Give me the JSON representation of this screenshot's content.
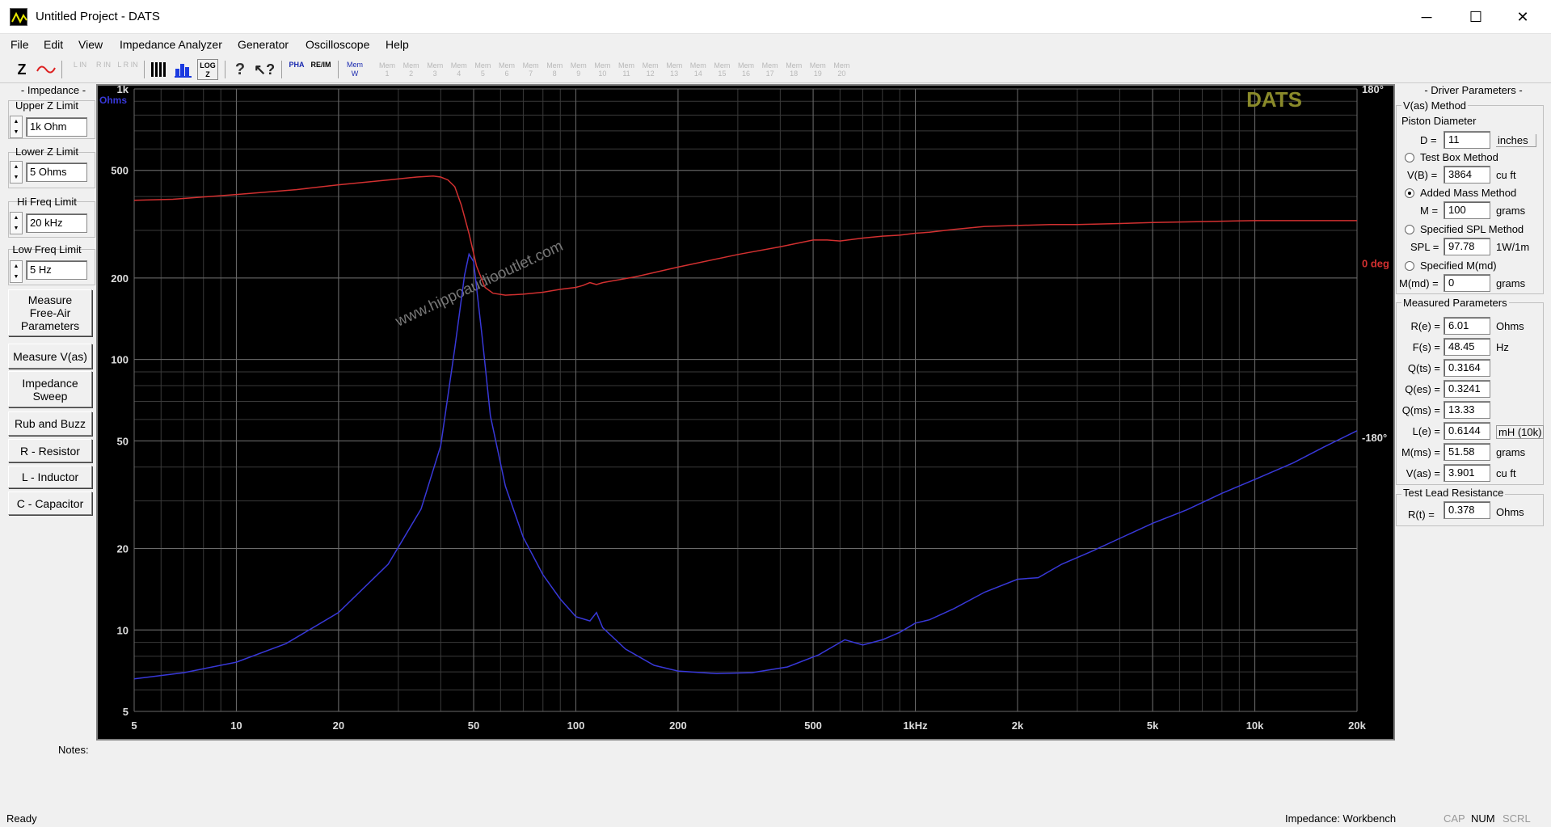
{
  "window": {
    "title": "Untitled Project - DATS",
    "minimize": "─",
    "maximize": "☐",
    "close": "✕"
  },
  "menu": [
    "File",
    "Edit",
    "View",
    "Impedance Analyzer",
    "Generator",
    "Oscilloscope",
    "Help"
  ],
  "toolbar": {
    "icons": [
      "impedance-z-icon",
      "phase-wave-icon",
      "l-in-icon",
      "r-in-icon",
      "lr-in-icon",
      "piano-keys-icon",
      "bar-chart-icon",
      "log-z-icon",
      "help-icon",
      "whats-this-icon",
      "phase-icon",
      "re-im-icon",
      "mem-w-icon"
    ],
    "z_label": "Z",
    "loc_label": "LOG Z",
    "pha_label": "PHA",
    "reim_label": "RE/IM",
    "memw_label": "Mem W",
    "l_in": "L IN",
    "r_in": "R IN",
    "lr_in": "L R IN",
    "mem_slots": [
      "1",
      "2",
      "3",
      "4",
      "5",
      "6",
      "7",
      "8",
      "9",
      "10",
      "11",
      "12",
      "13",
      "14",
      "15",
      "16",
      "17",
      "18",
      "19",
      "20"
    ],
    "mem_label": "Mem"
  },
  "left": {
    "header": "- Impedance -",
    "upper_z": {
      "label": "Upper Z Limit",
      "value": "1k Ohm"
    },
    "lower_z": {
      "label": "Lower Z Limit",
      "value": "5 Ohms"
    },
    "hi_freq": {
      "label": "Hi Freq Limit",
      "value": "20 kHz"
    },
    "low_freq": {
      "label": "Low Freq Limit",
      "value": "5 Hz"
    },
    "buttons": [
      "Measure\nFree-Air\nParameters",
      "Measure V(as)",
      "Impedance\nSweep",
      "Rub and Buzz",
      "R - Resistor",
      "L - Inductor",
      "C - Capacitor"
    ]
  },
  "notes_label": "Notes:",
  "right": {
    "header": "- Driver Parameters -",
    "vas_method": "V(as) Method",
    "piston_diameter": "Piston Diameter",
    "d": {
      "label": "D =",
      "value": "11",
      "unit": "inches"
    },
    "test_box": {
      "label": "Test Box Method",
      "selected": false
    },
    "vb": {
      "label": "V(B) =",
      "value": "3864",
      "unit": "cu ft"
    },
    "added_mass": {
      "label": "Added Mass Method",
      "selected": true
    },
    "m": {
      "label": "M =",
      "value": "100",
      "unit": "grams"
    },
    "spl_method": {
      "label": "Specified SPL Method",
      "selected": false
    },
    "spl": {
      "label": "SPL =",
      "value": "97.78",
      "unit": "1W/1m"
    },
    "mmd_method": {
      "label": "Specified M(md)",
      "selected": false
    },
    "mmd": {
      "label": "M(md) =",
      "value": "0",
      "unit": "grams"
    },
    "measured_header": "Measured Parameters",
    "measured": [
      {
        "label": "R(e) =",
        "value": "6.01",
        "unit": "Ohms"
      },
      {
        "label": "F(s) =",
        "value": "48.45",
        "unit": "Hz"
      },
      {
        "label": "Q(ts) =",
        "value": "0.3164",
        "unit": ""
      },
      {
        "label": "Q(es) =",
        "value": "0.3241",
        "unit": ""
      },
      {
        "label": "Q(ms) =",
        "value": "13.33",
        "unit": ""
      },
      {
        "label": "L(e) =",
        "value": "0.6144",
        "unit": "mH (10k)"
      },
      {
        "label": "M(ms) =",
        "value": "51.58",
        "unit": "grams"
      },
      {
        "label": "V(as) =",
        "value": "3.901",
        "unit": "cu ft"
      }
    ],
    "test_lead_header": "Test Lead Resistance",
    "rt": {
      "label": "R(t) =",
      "value": "0.378",
      "unit": "Ohms"
    }
  },
  "status": {
    "left": "Ready",
    "mode": "Impedance: Workbench",
    "cap": "CAP",
    "num": "NUM",
    "scrl": "SCRL"
  },
  "chart_data": {
    "type": "line",
    "brand": "DATS",
    "watermark": "www.hippoaudiooutlet.com",
    "x_scale": "log",
    "y_scale": "log",
    "xlim": [
      5,
      20000
    ],
    "ylim": [
      5,
      1000
    ],
    "y_unit": "Ohms",
    "x_ticks": [
      "5",
      "10",
      "20",
      "50",
      "100",
      "200",
      "500",
      "1kHz",
      "2k",
      "5k",
      "10k",
      "20k"
    ],
    "x_tick_values": [
      5,
      10,
      20,
      50,
      100,
      200,
      500,
      1000,
      2000,
      5000,
      10000,
      20000
    ],
    "y_ticks": [
      "1k",
      "500",
      "200",
      "100",
      "50",
      "20",
      "10",
      "5"
    ],
    "y_tick_values": [
      1000,
      500,
      200,
      100,
      50,
      20,
      10,
      5
    ],
    "phase_ticks": [
      "180°",
      "0 deg",
      "-180°"
    ],
    "phase_tick_values": [
      180,
      0,
      -180
    ],
    "phase_lim": [
      -180,
      180
    ],
    "grid": true,
    "colors": {
      "impedance": "#3838d8",
      "phase": "#d23030",
      "grid": "#3a3a3a",
      "brand": "#8a8a2a",
      "watermark": "#777777"
    },
    "series": [
      {
        "name": "impedance",
        "x": [
          5,
          7,
          10,
          14,
          20,
          28,
          35,
          40,
          44,
          47,
          48.45,
          50,
          53,
          56,
          62,
          70,
          80,
          90,
          100,
          110,
          115,
          120,
          140,
          170,
          200,
          260,
          330,
          420,
          520,
          620,
          700,
          800,
          900,
          1000,
          1100,
          1300,
          1600,
          2000,
          2300,
          2700,
          3300,
          4000,
          5000,
          6300,
          8000,
          10000,
          13000,
          16000,
          20000
        ],
        "y": [
          6.6,
          6.95,
          7.6,
          8.9,
          11.6,
          17.5,
          28,
          48,
          110,
          205,
          245,
          230,
          120,
          62,
          34,
          22,
          16,
          13,
          11.2,
          10.8,
          11.6,
          10.2,
          8.5,
          7.4,
          7.05,
          6.9,
          6.95,
          7.3,
          8.1,
          9.2,
          8.8,
          9.2,
          9.8,
          10.6,
          10.9,
          12,
          13.8,
          15.4,
          15.6,
          17.5,
          19.5,
          21.8,
          24.8,
          27.8,
          32,
          36,
          41.5,
          47.5,
          54.5
        ]
      },
      {
        "name": "phase",
        "x": [
          5,
          6.5,
          10,
          15,
          20,
          28,
          34,
          38,
          40,
          42,
          44,
          46,
          48.5,
          51,
          54,
          57,
          62,
          70,
          80,
          90,
          100,
          105,
          110,
          115,
          120,
          150,
          200,
          300,
          400,
          500,
          550,
          600,
          700,
          800,
          900,
          1000,
          1100,
          1300,
          1600,
          2000,
          2500,
          3000,
          4000,
          5000,
          7000,
          10000,
          14000,
          20000
        ],
        "phase": [
          65,
          66,
          71,
          76,
          81,
          86,
          89,
          90,
          89,
          86,
          79,
          60,
          30,
          -3,
          -25,
          -31,
          -33,
          -32,
          -30,
          -27,
          -25,
          -23,
          -20,
          -22,
          -20,
          -14,
          -4,
          9,
          17,
          24,
          24,
          23,
          26,
          28,
          29,
          31,
          32,
          35,
          38,
          39,
          40,
          40,
          41,
          42,
          43,
          44,
          44,
          44
        ]
      }
    ]
  }
}
